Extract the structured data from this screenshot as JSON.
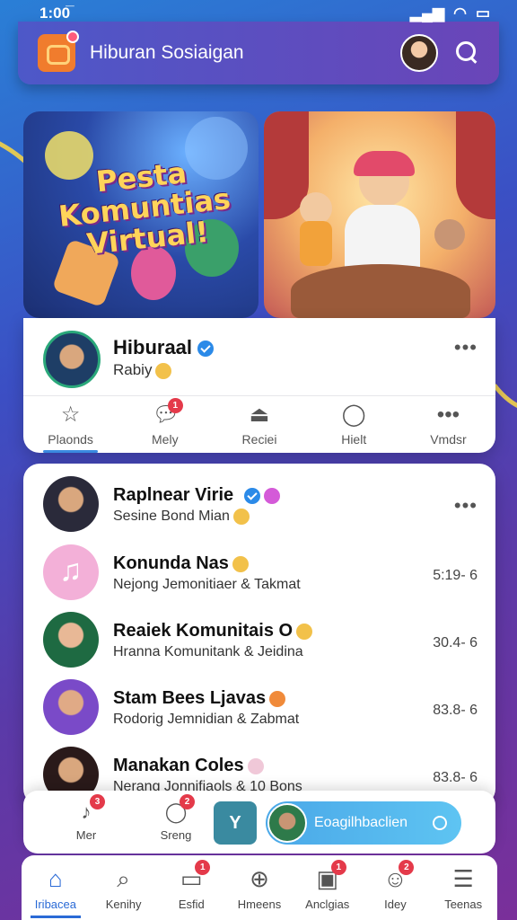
{
  "status": {
    "time": "1:00̅"
  },
  "header": {
    "title": "Hiburan Sosiaigan"
  },
  "banner": {
    "title": "Pesta Komuntias Virtual!"
  },
  "profile": {
    "name": "Hiburaal",
    "subtitle": "Rabiy",
    "tabs": [
      {
        "label": "Plaonds",
        "icon": "star-icon",
        "badge": ""
      },
      {
        "label": "Mely",
        "icon": "chat-bubble-icon",
        "badge": "1"
      },
      {
        "label": "Reciei",
        "icon": "broom-icon",
        "badge": ""
      },
      {
        "label": "Hielt",
        "icon": "heart-bubble-icon",
        "badge": ""
      },
      {
        "label": "Vmdsr",
        "icon": "more-icon",
        "badge": ""
      }
    ]
  },
  "list": [
    {
      "name": "Raplnear Virie",
      "sub": "Sesine Bond Mian",
      "time": ""
    },
    {
      "name": "Konunda Nas",
      "sub": "Nejong Jemonitiaer & Takmat",
      "time": "5:19- 6"
    },
    {
      "name": "Reaiek Komunitais O",
      "sub": "Hranna Komunitank & Jeidina",
      "time": "30.4- 6"
    },
    {
      "name": "Stam Bees Ljavas",
      "sub": "Rodorig Jemnidian & Zabmat",
      "time": "83.8- 6"
    },
    {
      "name": "Manakan Coles",
      "sub": "Nerang Jonnifiaols & 10 Bons",
      "time": "83.8- 6"
    }
  ],
  "actions": {
    "mer": {
      "label": "Mer",
      "badge": "3"
    },
    "sreng": {
      "label": "Sreng",
      "badge": "2"
    },
    "y_label": "Y",
    "live_label": "Eoagilhbaclien"
  },
  "nav": [
    {
      "label": "Iribacea",
      "icon": "home-icon",
      "badge": ""
    },
    {
      "label": "Kenihy",
      "icon": "search-icon",
      "badge": ""
    },
    {
      "label": "Esfid",
      "icon": "inbox-icon",
      "badge": "1"
    },
    {
      "label": "Hmeens",
      "icon": "globe-icon",
      "badge": ""
    },
    {
      "label": "Anclgias",
      "icon": "gift-icon",
      "badge": "1"
    },
    {
      "label": "Idey",
      "icon": "face-icon",
      "badge": "2"
    },
    {
      "label": "Teenas",
      "icon": "menu-icon",
      "badge": ""
    }
  ]
}
